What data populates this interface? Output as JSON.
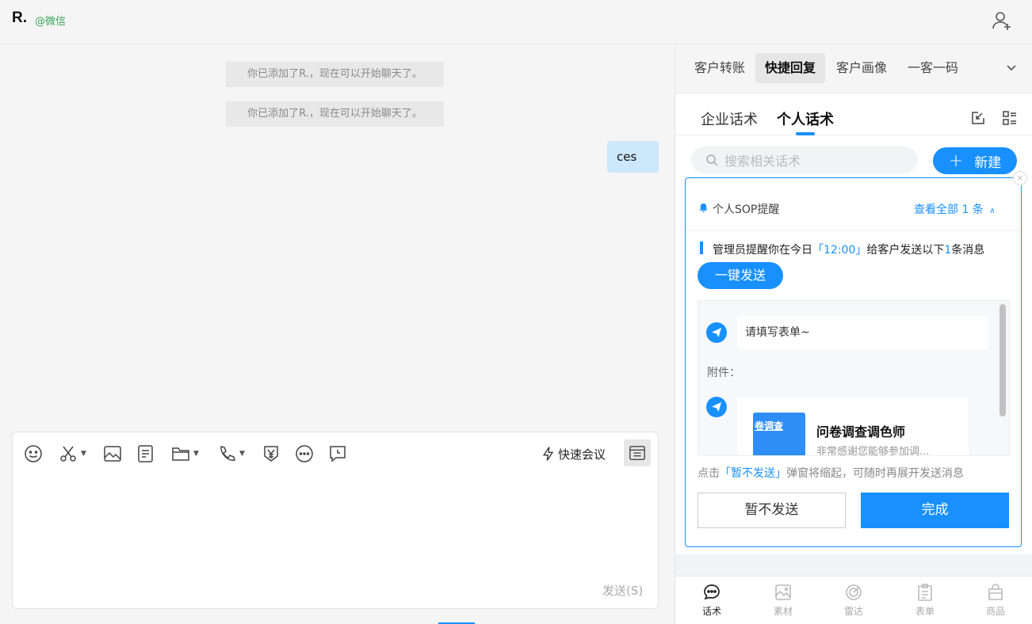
{
  "header": {
    "contact_name": "R.",
    "contact_source": "@微信"
  },
  "chat": {
    "system_messages": [
      "你已添加了R.，现在可以开始聊天了。",
      "你已添加了R.，现在可以开始聊天了。"
    ],
    "my_message": "ces"
  },
  "composer": {
    "quick_meeting_label": "快速会议",
    "send_label": "发送(S)",
    "toolbar_icons": [
      "emoji-icon",
      "scissors-icon",
      "image-icon",
      "document-icon",
      "folder-icon",
      "phone-icon",
      "yen-shield-icon",
      "more-icon",
      "chat-record-icon"
    ]
  },
  "side": {
    "tabs": [
      "客户转账",
      "快捷回复",
      "客户画像",
      "一客一码"
    ],
    "active_tab": "快捷回复",
    "sub_tabs": [
      "企业话术",
      "个人话术"
    ],
    "active_sub_tab": "个人话术",
    "search_placeholder": "搜索相关话术",
    "new_button": "新建",
    "bottom_nav": [
      "话术",
      "素材",
      "雷达",
      "表单",
      "商品"
    ]
  },
  "sop": {
    "title": "个人SOP提醒",
    "view_all": "查看全部 1 条",
    "remind_prefix": "管理员提醒你在今日",
    "remind_time": "「12:00」",
    "remind_middle": "给客户发送以下",
    "remind_count": "1",
    "remind_suffix": "条消息",
    "one_key_send": "一键发送",
    "message_text": "请填写表单~",
    "attachment_label": "附件：",
    "attachment_title": "问卷调查调色师",
    "attachment_desc": "非常感谢您能够参加调...",
    "attachment_thumb_label": "卷调查",
    "hint_prefix": "点击",
    "hint_action": "「暂不发送」",
    "hint_suffix": "弹窗将缩起，可随时再展开发送消息",
    "btn_later": "暂不发送",
    "btn_done": "完成",
    "close_glyph": "×"
  },
  "colors": {
    "accent": "#1890ff",
    "my_bubble": "#cde7fb",
    "source_green": "#3aa55a"
  }
}
